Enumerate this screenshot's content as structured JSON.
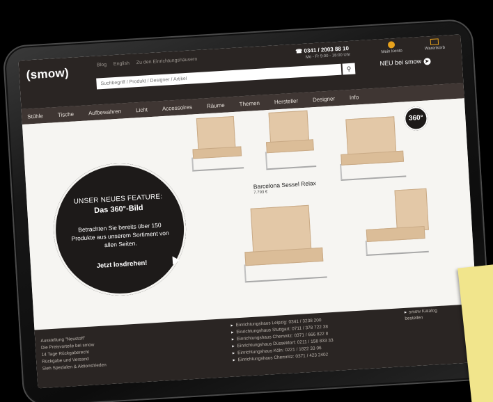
{
  "header": {
    "logo": "(smow)",
    "top_links": [
      "Blog",
      "English",
      "Zu den Einrichtungshäusern"
    ],
    "search_placeholder": "Suchbegriff / Produkt / Designer / Artikel",
    "search_button_icon": "search-icon",
    "phone": "0341 / 2003 88 10",
    "hours": "Mo - Fr 9:00 - 18:00 Uhr",
    "account_label": "Mein Konto",
    "cart_label": "Warenkorb",
    "new_label": "NEU bei smow",
    "accent_color": "#e8a21c"
  },
  "nav": [
    "Stühle",
    "Tische",
    "Aufbewahren",
    "Licht",
    "Accessoires",
    "Räume",
    "Themen",
    "Hersteller",
    "Designer",
    "Info"
  ],
  "feature": {
    "title": "UNSER NEUES FEATURE:",
    "subtitle": "Das 360°-Bild",
    "text": "Betrachten Sie bereits über 150 Produkte aus unserem Sortiment von allen Seiten.",
    "cta": "Jetzt losdrehen!"
  },
  "product": {
    "name": "Barcelona Sessel Relax",
    "price": "7.793 €",
    "badge": "360°"
  },
  "footer": {
    "col1": [
      "Ausstellung \"Neustoff\"",
      "Die Preisvorteile bei smow",
      "14 Tage Rückgaberecht",
      "Rückgabe und Versand",
      "Sieh Spezialen & Aktionsfrieden"
    ],
    "col2": [
      "Einrichtungshaus Leipzig: 0341 / 3238 200",
      "Einrichtungshaus Stuttgart: 0711 / 378 722 38",
      "Einrichtungshaus Chemnitz: 0371 / 666 822 8",
      "Einrichtungshaus Düsseldorf: 0211 / 158 833 33",
      "Einrichtungshaus Köln: 0221 / 1822 33 06",
      "Einrichtungshaus Chemnitz: 0371 / 423 2402"
    ],
    "col3": "smow Katalog bestellen"
  }
}
